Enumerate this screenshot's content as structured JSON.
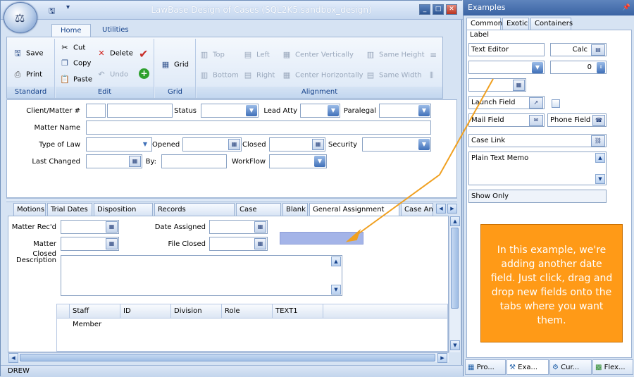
{
  "window": {
    "title": "LawBase Design of Cases (SQL2K5.sandbox_design)",
    "min": "_",
    "max": "□",
    "close": "✕"
  },
  "ribbon_tabs": [
    {
      "label": "Home"
    },
    {
      "label": "Utilities"
    }
  ],
  "ribbon": {
    "standard": {
      "label": "Standard",
      "save": "Save",
      "print": "Print"
    },
    "edit": {
      "label": "Edit",
      "cut": "Cut",
      "copy": "Copy",
      "paste": "Paste",
      "delete": "Delete",
      "undo": "Undo"
    },
    "grid": {
      "label": "Grid",
      "grid": "Grid"
    },
    "alignment": {
      "label": "Alignment",
      "top": "Top",
      "bottom": "Bottom",
      "left": "Left",
      "right": "Right",
      "center_vertically": "Center Vertically",
      "center_horizontally": "Center Horizontally",
      "same_height": "Same Height",
      "same_width": "Same Width"
    }
  },
  "form": {
    "client_matter": "Client/Matter #",
    "status": "Status",
    "lead_atty": "Lead Atty",
    "paralegal": "Paralegal",
    "matter_name": "Matter Name",
    "type_of_law": "Type of Law",
    "opened": "Opened",
    "closed": "Closed",
    "security": "Security",
    "last_changed": "Last Changed",
    "by": "By:",
    "workflow": "WorkFlow"
  },
  "tabs": [
    {
      "label": "Motions"
    },
    {
      "label": "Trial Dates"
    },
    {
      "label": "Disposition Info"
    },
    {
      "label": "Records Management"
    },
    {
      "label": "Case Value"
    },
    {
      "label": "Blank"
    },
    {
      "label": "General Assignment Info"
    },
    {
      "label": "Case An"
    }
  ],
  "panel": {
    "matter_recd": "Matter Rec'd",
    "matter_closed": "Matter Closed",
    "date_assigned": "Date Assigned",
    "file_closed": "File Closed",
    "description": "Description",
    "grid_columns": [
      "Staff Member",
      "ID",
      "Division",
      "Role",
      "TEXT1"
    ]
  },
  "status": {
    "user": "DREW"
  },
  "side": {
    "title": "Examples",
    "tabs": [
      {
        "label": "Common"
      },
      {
        "label": "Exotic"
      },
      {
        "label": "Containers"
      }
    ],
    "label": "Label",
    "text_editor": "Text Editor",
    "calc": "Calc",
    "number_value": "0",
    "launch_field": "Launch Field",
    "mail_field": "Mail Field",
    "phone_field": "Phone Field",
    "case_link": "Case Link",
    "plain_text_memo": "Plain Text Memo",
    "show_only": "Show Only",
    "bottom_tabs": [
      {
        "label": "Pro..."
      },
      {
        "label": "Exa..."
      },
      {
        "label": "Cur..."
      },
      {
        "label": "Flex..."
      }
    ]
  },
  "callout": {
    "text": "In this example, we're adding another date field. Just click, drag and drop new fields onto the tabs where you want them."
  },
  "colors": {
    "accent": "#15428b",
    "callout": "#ff9a17",
    "dropzone": "#a4b4e8"
  }
}
